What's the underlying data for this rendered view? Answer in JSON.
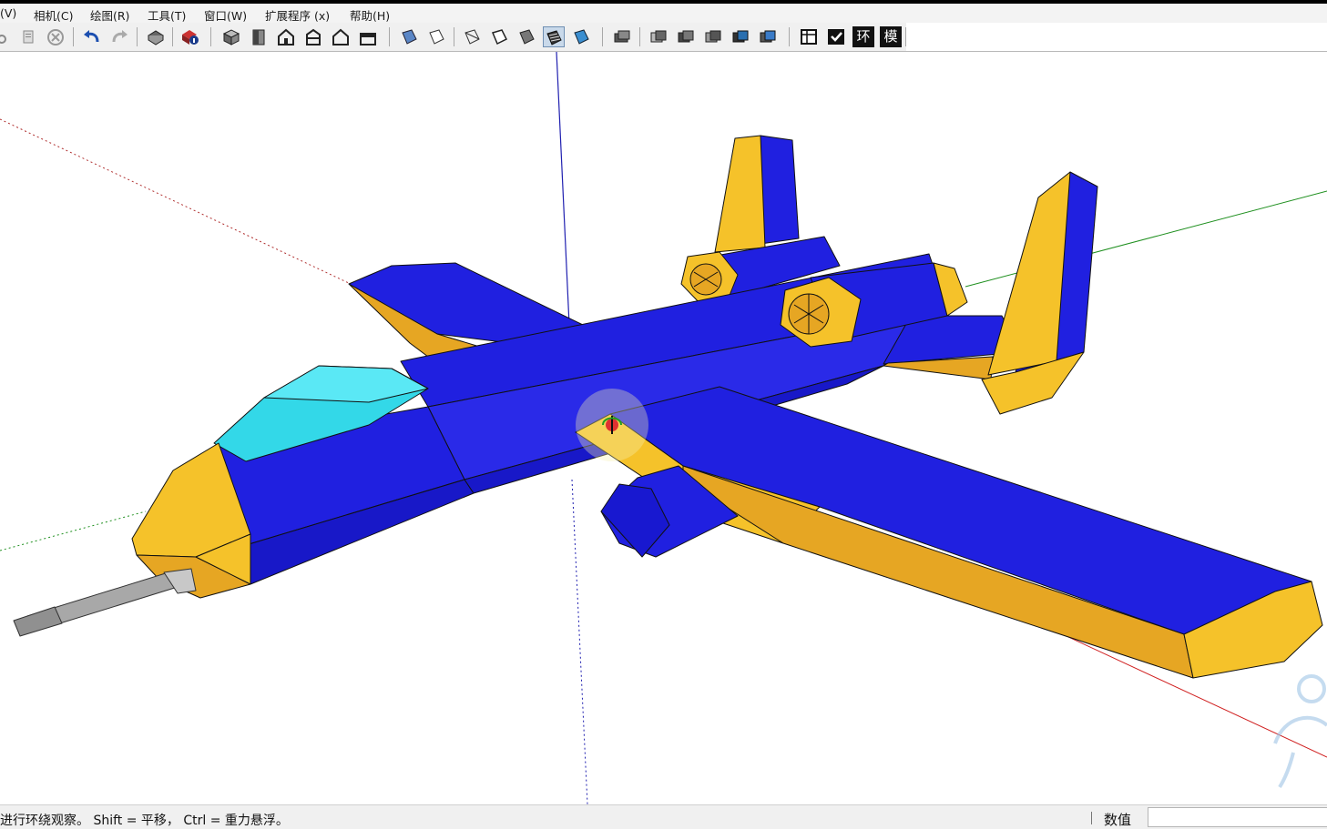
{
  "menu": {
    "items": [
      {
        "label": "(V)"
      },
      {
        "label": "相机(C)"
      },
      {
        "label": "绘图(R)"
      },
      {
        "label": "工具(T)"
      },
      {
        "label": "窗口(W)"
      },
      {
        "label": "扩展程序 (x)"
      },
      {
        "label": "帮助(H)"
      }
    ]
  },
  "toolbar": {
    "extension_labels": [
      "环",
      "模"
    ],
    "active_tool": "monochrome-style-icon"
  },
  "colors": {
    "body_blue": "#2020e0",
    "accent_yellow": "#f5c22a",
    "canopy_cyan": "#33d8e8",
    "axis_red": "#d02020",
    "axis_green": "#209020",
    "axis_blue": "#2020b0"
  },
  "viewport": {
    "model": "low-poly attack aircraft",
    "tool_cursor": "orbit-cursor-icon"
  },
  "status": {
    "hint": "进行环绕观察。 Shift = 平移， Ctrl = 重力悬浮。",
    "vcb_label": "数值",
    "vcb_value": ""
  }
}
